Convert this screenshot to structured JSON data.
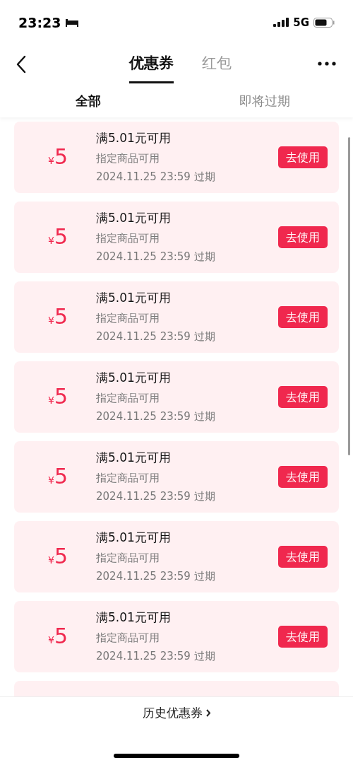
{
  "status_bar": {
    "time": "23:23",
    "network": "5G"
  },
  "nav": {
    "tabs": [
      {
        "label": "优惠券",
        "selected": true
      },
      {
        "label": "红包",
        "selected": false
      }
    ]
  },
  "filters": [
    {
      "label": "全部",
      "selected": true
    },
    {
      "label": "即将过期",
      "selected": false
    }
  ],
  "coupons": [
    {
      "currency": "¥",
      "amount": "5",
      "title": "满5.01元可用",
      "scope": "指定商品可用",
      "expiry": "2024.11.25 23:59 过期",
      "action": "去使用"
    },
    {
      "currency": "¥",
      "amount": "5",
      "title": "满5.01元可用",
      "scope": "指定商品可用",
      "expiry": "2024.11.25 23:59 过期",
      "action": "去使用"
    },
    {
      "currency": "¥",
      "amount": "5",
      "title": "满5.01元可用",
      "scope": "指定商品可用",
      "expiry": "2024.11.25 23:59 过期",
      "action": "去使用"
    },
    {
      "currency": "¥",
      "amount": "5",
      "title": "满5.01元可用",
      "scope": "指定商品可用",
      "expiry": "2024.11.25 23:59 过期",
      "action": "去使用"
    },
    {
      "currency": "¥",
      "amount": "5",
      "title": "满5.01元可用",
      "scope": "指定商品可用",
      "expiry": "2024.11.25 23:59 过期",
      "action": "去使用"
    },
    {
      "currency": "¥",
      "amount": "5",
      "title": "满5.01元可用",
      "scope": "指定商品可用",
      "expiry": "2024.11.25 23:59 过期",
      "action": "去使用"
    },
    {
      "currency": "¥",
      "amount": "5",
      "title": "满5.01元可用",
      "scope": "指定商品可用",
      "expiry": "2024.11.25 23:59 过期",
      "action": "去使用"
    }
  ],
  "history_link": {
    "label": "历史优惠券"
  }
}
